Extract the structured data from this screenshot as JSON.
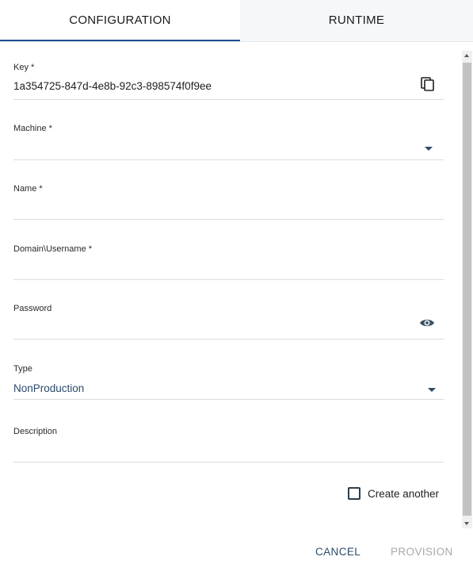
{
  "tabs": {
    "configuration": "CONFIGURATION",
    "runtime": "RUNTIME"
  },
  "form": {
    "key": {
      "label": "Key *",
      "value": "1a354725-847d-4e8b-92c3-898574f0f9ee",
      "icon": "copy-icon"
    },
    "machine": {
      "label": "Machine *",
      "value": "",
      "icon": "dropdown-caret-icon"
    },
    "name": {
      "label": "Name *",
      "value": ""
    },
    "username": {
      "label": "Domain\\Username *",
      "value": ""
    },
    "password": {
      "label": "Password",
      "value": "",
      "icon": "eye-icon"
    },
    "type": {
      "label": "Type",
      "value": "NonProduction",
      "icon": "dropdown-caret-icon"
    },
    "description": {
      "label": "Description",
      "value": ""
    }
  },
  "create_another": {
    "label": "Create another",
    "checked": false
  },
  "footer": {
    "cancel": "CANCEL",
    "provision": "PROVISION"
  },
  "colors": {
    "accent": "#1f4f8f",
    "link": "#2c4b6a",
    "disabled": "#a8a8a8"
  }
}
